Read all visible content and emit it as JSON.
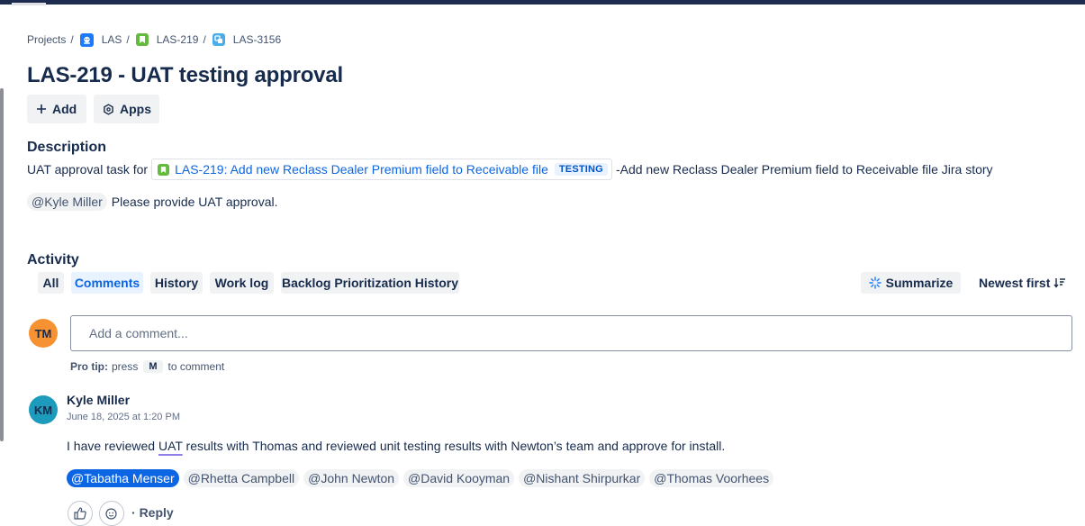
{
  "breadcrumb": {
    "projects": "Projects",
    "project": "LAS",
    "parent": "LAS-219",
    "issue": "LAS-3156",
    "separator": "/",
    "icons": [
      "project-avatar-icon",
      "story-icon",
      "subtask-icon"
    ]
  },
  "issue": {
    "title": "LAS-219 - UAT testing approval"
  },
  "toolbar": {
    "add_label": "Add",
    "apps_label": "Apps"
  },
  "description": {
    "heading": "Description",
    "prefix": "UAT approval task for",
    "link_text": "LAS-219: Add new Reclass Dealer Premium field to Receivable file",
    "link_status": "TESTING",
    "suffix": "-Add new Reclass Dealer Premium field to Receivable file Jira story",
    "mention": "@Kyle Miller",
    "request": "Please provide UAT approval."
  },
  "activity": {
    "heading": "Activity",
    "tabs": [
      {
        "label": "All",
        "active": false
      },
      {
        "label": "Comments",
        "active": true
      },
      {
        "label": "History",
        "active": false
      },
      {
        "label": "Work log",
        "active": false
      },
      {
        "label": "Backlog Prioritization History",
        "active": false
      }
    ],
    "summarize_label": "Summarize",
    "sort_label": "Newest first"
  },
  "composer": {
    "avatar_initials": "TM",
    "placeholder": "Add a comment...",
    "protip_label": "Pro tip:",
    "protip_pre": "press",
    "protip_key": "M",
    "protip_post": "to comment"
  },
  "comment": {
    "avatar_initials": "KM",
    "author": "Kyle Miller",
    "timestamp": "June 18, 2025 at 1:20 PM",
    "body_pre": "I have reviewed ",
    "body_highlight": "UAT",
    "body_post": " results with Thomas and reviewed unit testing results with Newton’s team and approve for install.",
    "mentions": [
      "@Tabatha Menser",
      "@Rhetta Campbell",
      "@John Newton",
      "@David Kooyman",
      "@Nishant Shirpurkar",
      "@Thomas Voorhees"
    ],
    "reply_label": "Reply",
    "reply_separator": "·"
  },
  "colors": {
    "accent": "#0c66e4",
    "text": "#172b4d",
    "tm_avatar": "#f79232",
    "km_avatar": "#1d9bbd",
    "topbar": "#1d2b4f"
  }
}
